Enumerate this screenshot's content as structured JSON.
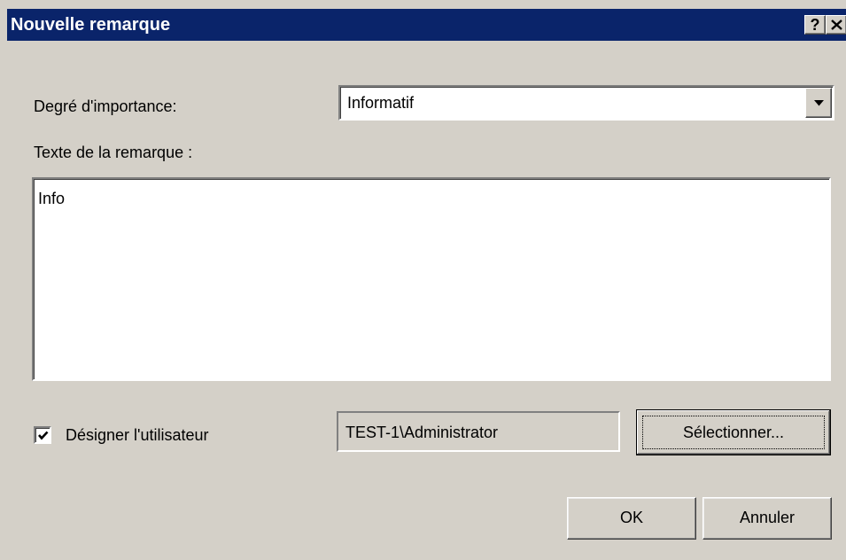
{
  "dialog": {
    "title": "Nouvelle remarque",
    "help_label": "?",
    "icons": {
      "close": "close-icon",
      "dropdown": "chevron-down-icon",
      "check": "checkmark-icon"
    }
  },
  "form": {
    "importance_label": "Degré d'importance:",
    "importance_value": "Informatif",
    "text_label": "Texte de la remarque :",
    "text_value": "Info",
    "assign_user_label": "Désigner l'utilisateur",
    "assign_user_checked": true,
    "user_value": "TEST-1\\Administrator",
    "select_button_label": "Sélectionner..."
  },
  "buttons": {
    "ok_label": "OK",
    "cancel_label": "Annuler"
  },
  "colors": {
    "face": "#d4d0c8",
    "titlebar": "#0a246a",
    "title_text": "#ffffff",
    "field_bg": "#ffffff"
  }
}
